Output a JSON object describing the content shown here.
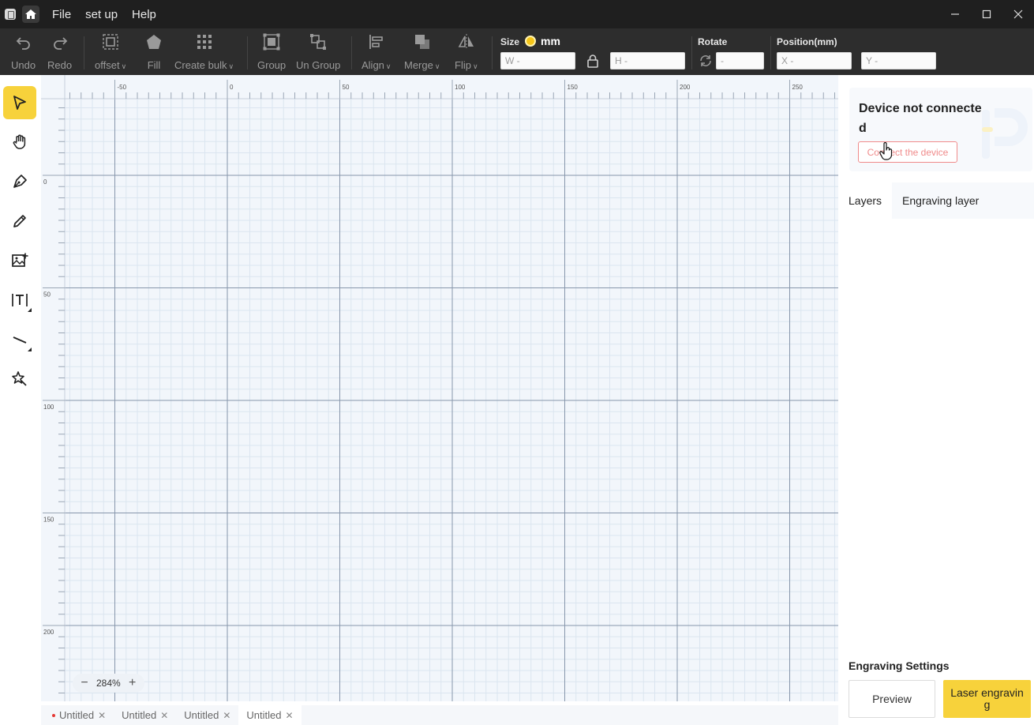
{
  "menu": {
    "file": "File",
    "setup": "set up",
    "help": "Help"
  },
  "toolbar": {
    "undo": "Undo",
    "redo": "Redo",
    "offset": "offset",
    "fill": "Fill",
    "create_bulk": "Create bulk",
    "group": "Group",
    "ungroup": "Un Group",
    "align": "Align",
    "merge": "Merge",
    "flip": "Flip",
    "size_title": "Size",
    "unit": "mm",
    "w_placeholder": "W -",
    "h_placeholder": "H -",
    "rotate_title": "Rotate",
    "rotate_placeholder": "-",
    "position_title": "Position(mm)",
    "x_placeholder": "X -",
    "y_placeholder": "Y -"
  },
  "tools": [
    "select-tool",
    "hand-tool",
    "pen-tool",
    "pencil-tool",
    "image-tool",
    "text-tool",
    "line-tool",
    "magic-tool"
  ],
  "ruler": {
    "x_labels": [
      "-50",
      "0",
      "50",
      "100",
      "150",
      "200",
      "250"
    ],
    "y_labels": [
      "0",
      "50",
      "100",
      "150",
      "200"
    ]
  },
  "zoom": {
    "value": "284%"
  },
  "doc_tabs": [
    {
      "label": "Untitled",
      "modified": true
    },
    {
      "label": "Untitled",
      "modified": false
    },
    {
      "label": "Untitled",
      "modified": false
    },
    {
      "label": "Untitled",
      "modified": false
    }
  ],
  "device": {
    "title": "Device not connected",
    "connect_button": "Connect the device"
  },
  "panel_tabs": {
    "layers": "Layers",
    "engraving_layer": "Engraving layer"
  },
  "engraving": {
    "title": "Engraving Settings",
    "preview": "Preview",
    "laser": "Laser engraving"
  },
  "colors": {
    "accent": "#f7d23b",
    "toolbar_bg": "#2d2d2d",
    "titlebar_bg": "#1f1f1f",
    "canvas_bg": "#f2f6fb",
    "danger": "#f08b8b"
  }
}
